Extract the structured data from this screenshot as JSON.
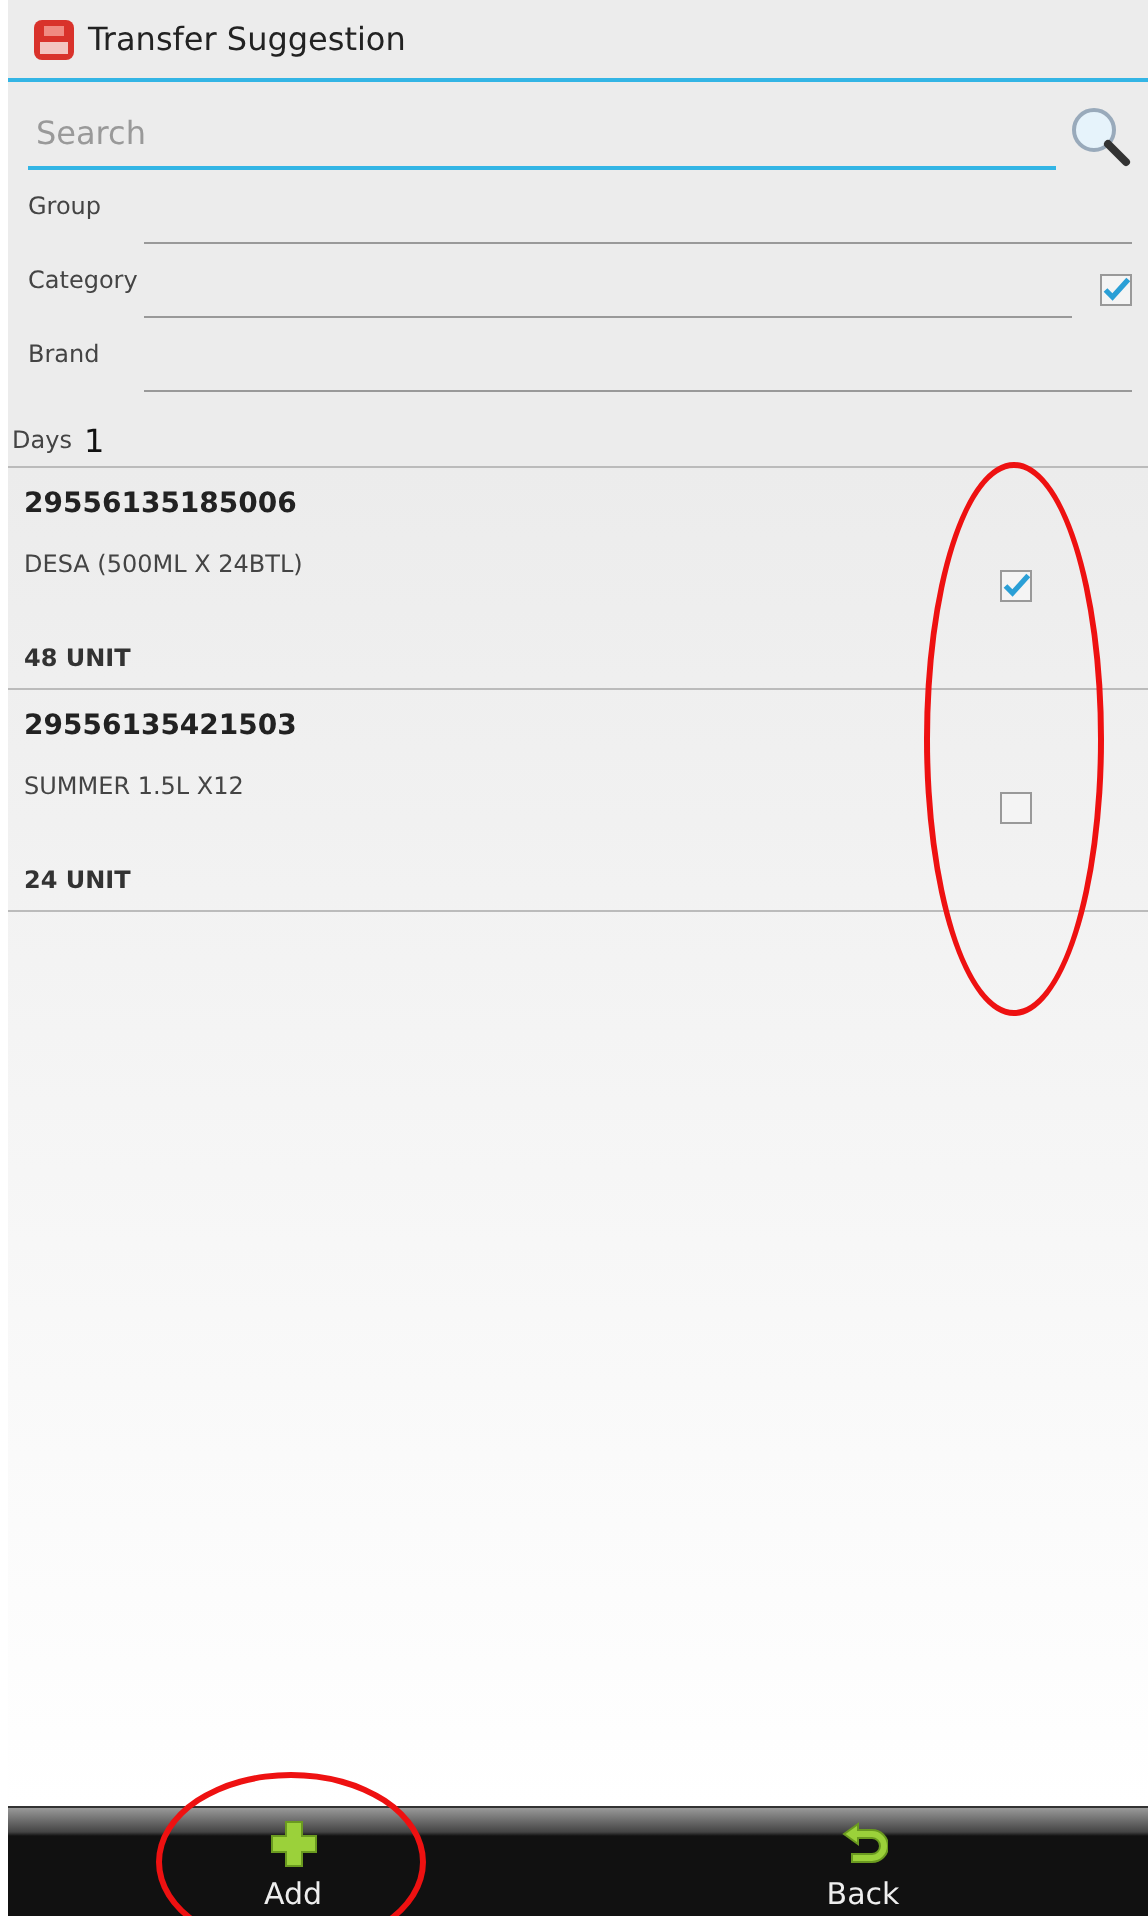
{
  "window": {
    "title": "Transfer Suggestion"
  },
  "search": {
    "placeholder": "Search"
  },
  "filters": [
    {
      "label": "Group",
      "kind": "text"
    },
    {
      "label": "Category",
      "kind": "check",
      "checked": true
    },
    {
      "label": "Brand",
      "kind": "text"
    }
  ],
  "days": {
    "label": "Days",
    "value": "1"
  },
  "items": [
    {
      "code": "29556135185006",
      "name": "DESA (500ML X 24BTL)",
      "quantity": "48 UNIT",
      "checked": true
    },
    {
      "code": "29556135421503",
      "name": "SUMMER 1.5L X12",
      "quantity": "24 UNIT",
      "checked": false
    }
  ],
  "item_checks_circled": true,
  "actions": [
    {
      "label": "Add",
      "kind": "add",
      "circled": true
    },
    {
      "label": "Back",
      "kind": "back",
      "circled": false
    }
  ]
}
